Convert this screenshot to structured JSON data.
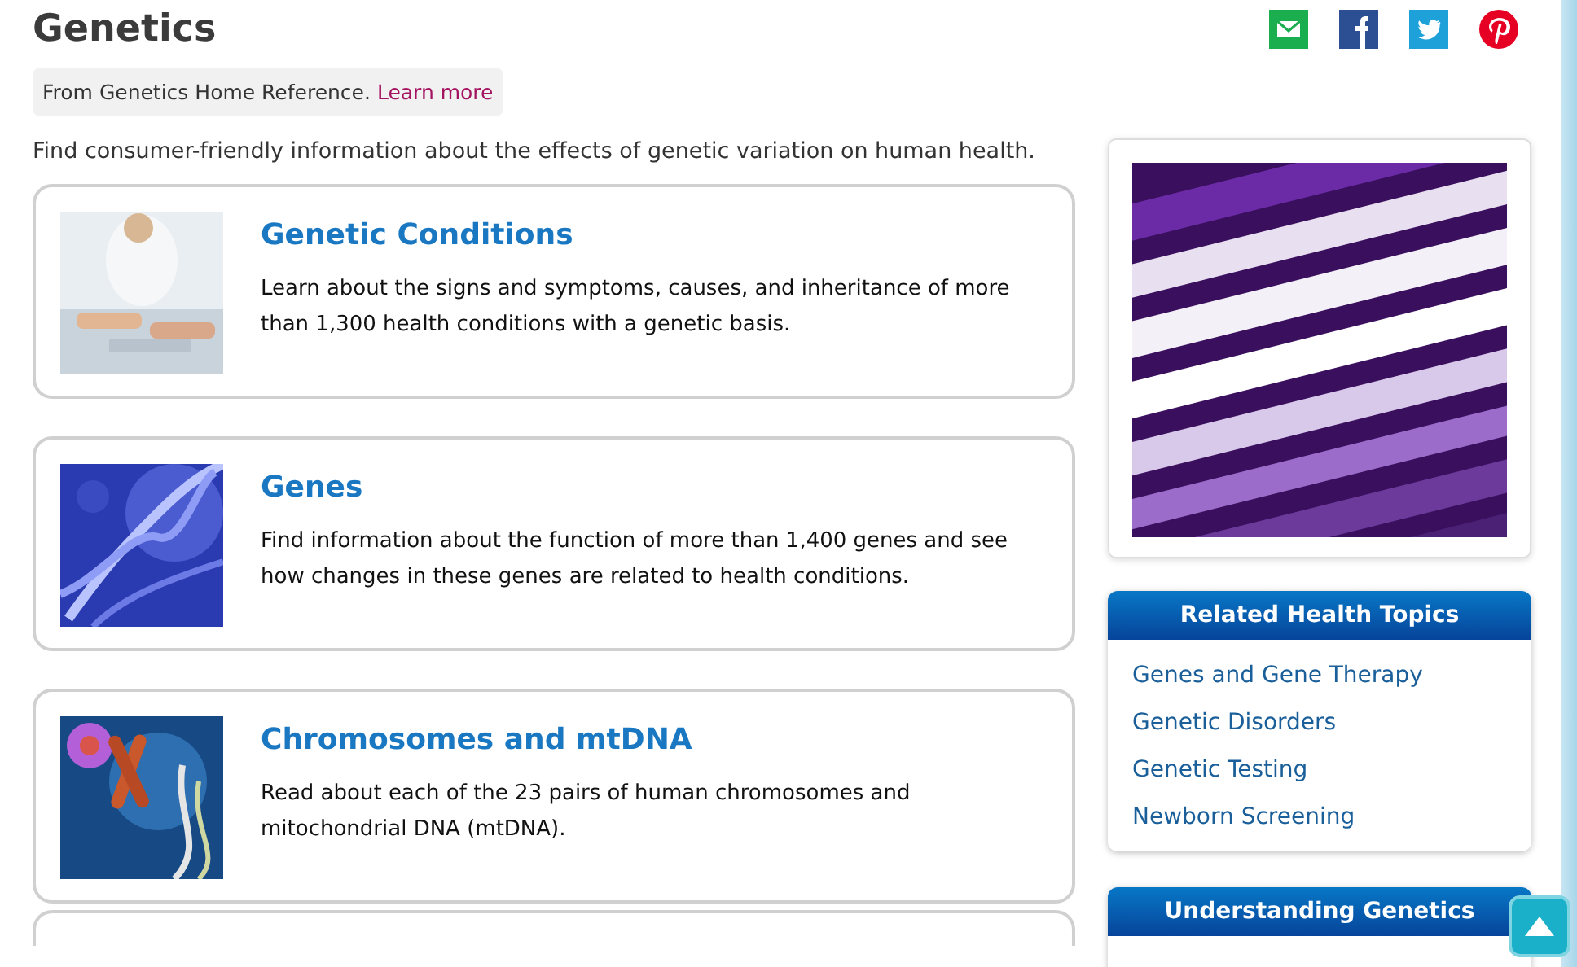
{
  "header": {
    "title": "Genetics",
    "share_icons": [
      {
        "kind": "email"
      },
      {
        "kind": "facebook"
      },
      {
        "kind": "twitter"
      },
      {
        "kind": "pinterest"
      }
    ]
  },
  "source": {
    "text": "From Genetics Home Reference.",
    "link": "Learn more"
  },
  "intro": "Find consumer-friendly information about the effects of genetic variation on human health.",
  "cards": [
    {
      "title": "Genetic Conditions",
      "description": "Learn about the signs and symptoms, causes, and inheritance of more than 1,300 health conditions with a genetic basis."
    },
    {
      "title": "Genes",
      "description": "Find information about the function of more than 1,400 genes and see how changes in these genes are related to health conditions."
    },
    {
      "title": "Chromosomes and mtDNA",
      "description": "Read about each of the 23 pairs of human chromosomes and mitochondrial DNA (mtDNA)."
    }
  ],
  "sidebar": {
    "related": {
      "title": "Related Health Topics",
      "links": [
        "Genes and Gene Therapy",
        "Genetic Disorders",
        "Genetic Testing",
        "Newborn Screening"
      ]
    },
    "understanding": {
      "title": "Understanding Genetics"
    }
  }
}
